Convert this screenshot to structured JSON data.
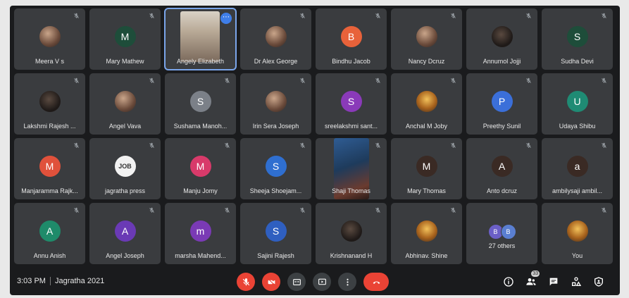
{
  "tiles": [
    {
      "name": "Meera V s",
      "kind": "photo",
      "variant": "",
      "letter": "",
      "color": ""
    },
    {
      "name": "Mary Mathew",
      "kind": "letter",
      "letter": "M",
      "color": "#1e4d3a"
    },
    {
      "name": "Angely Elizabeth",
      "kind": "video",
      "active": true
    },
    {
      "name": "Dr Alex George",
      "kind": "photo",
      "variant": ""
    },
    {
      "name": "Bindhu Jacob",
      "kind": "letter",
      "letter": "B",
      "color": "#e8623a"
    },
    {
      "name": "Nancy Dcruz",
      "kind": "photo",
      "variant": ""
    },
    {
      "name": "Annumol Jojji",
      "kind": "photo",
      "variant": "dark"
    },
    {
      "name": "Sudha Devi",
      "kind": "letter",
      "letter": "S",
      "color": "#1e4d3a"
    },
    {
      "name": "Lakshmi Rajesh ...",
      "kind": "photo",
      "variant": "dark"
    },
    {
      "name": "Angel Vava",
      "kind": "photo",
      "variant": ""
    },
    {
      "name": "Sushama Manoh...",
      "kind": "letter",
      "letter": "S",
      "color": "#7b8088"
    },
    {
      "name": "Irin Sera Joseph",
      "kind": "photo",
      "variant": ""
    },
    {
      "name": "sreelakshmi sant...",
      "kind": "letter",
      "letter": "S",
      "color": "#8a3ab9"
    },
    {
      "name": "Anchal M Joby",
      "kind": "photo",
      "variant": "warm"
    },
    {
      "name": "Preethy Sunil",
      "kind": "letter",
      "letter": "P",
      "color": "#3b6fd9"
    },
    {
      "name": "Udaya Shibu",
      "kind": "letter",
      "letter": "U",
      "color": "#1f8b74"
    },
    {
      "name": "Manjaramma Rajk...",
      "kind": "letter",
      "letter": "M",
      "color": "#e0513b"
    },
    {
      "name": "jagratha press",
      "kind": "photo",
      "variant": "logo",
      "letter": "JOB"
    },
    {
      "name": "Manju Jomy",
      "kind": "letter",
      "letter": "M",
      "color": "#d83a6a"
    },
    {
      "name": "Sheeja Shoejam...",
      "kind": "letter",
      "letter": "S",
      "color": "#2f6fd0"
    },
    {
      "name": "Shaji Thomas",
      "kind": "video2"
    },
    {
      "name": "Mary Thomas",
      "kind": "letter",
      "letter": "M",
      "color": "#3a2a24"
    },
    {
      "name": "Anto dcruz",
      "kind": "letter",
      "letter": "A",
      "color": "#3a2a24"
    },
    {
      "name": "ambilysaji ambil...",
      "kind": "letter",
      "letter": "a",
      "color": "#3a2a24"
    },
    {
      "name": "Annu Anish",
      "kind": "letter",
      "letter": "A",
      "color": "#1f8b6a"
    },
    {
      "name": "Angel Joseph",
      "kind": "letter",
      "letter": "A",
      "color": "#6a3ab5"
    },
    {
      "name": "marsha Mahend...",
      "kind": "letter",
      "letter": "m",
      "color": "#7a3ab5"
    },
    {
      "name": "Sajini Rajesh",
      "kind": "letter",
      "letter": "S",
      "color": "#2f5fc0"
    },
    {
      "name": "Krishnanand H",
      "kind": "photo",
      "variant": "dark"
    },
    {
      "name": "Abhinav. Shine",
      "kind": "photo",
      "variant": "warm"
    },
    {
      "name": "27 others",
      "kind": "others",
      "a": "B",
      "b": "B"
    },
    {
      "name": "You",
      "kind": "photo",
      "variant": "warm"
    }
  ],
  "bottom": {
    "time": "3:03 PM",
    "meeting": "Jagratha 2021"
  },
  "icons": {
    "mic": "mic-off-icon",
    "cam": "camera-off-icon",
    "cc": "captions-icon",
    "present": "present-icon",
    "more": "more-vert-icon",
    "hangup": "call-end-icon",
    "info": "info-icon",
    "people": "people-icon",
    "chat": "chat-icon",
    "activities": "activities-icon",
    "lock": "host-controls-icon"
  },
  "people_count": "33",
  "colors": {
    "accent": "#7aa5ea",
    "danger": "#ea4335",
    "tile": "#3a3c3f",
    "bg": "#1a1b1d"
  }
}
